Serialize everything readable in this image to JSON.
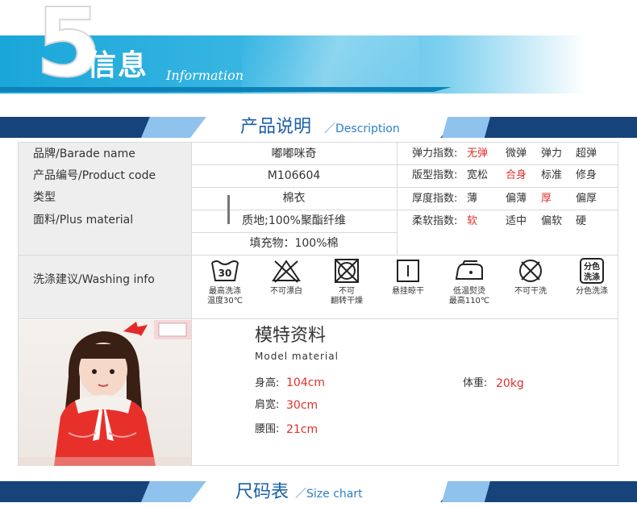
{
  "header": {
    "number": "5",
    "title_cn": "信息",
    "title_en": "Information"
  },
  "sections": {
    "description": {
      "cn": "产品说明",
      "en": "Description"
    },
    "size_chart": {
      "cn": "尺码表",
      "en": "Size chart"
    }
  },
  "product": {
    "brand_label": "品牌/Barade name",
    "brand_value": "嘟嘟咪奇",
    "code_label": "产品编号/Product code",
    "code_value": "M106604",
    "type_label": "类型",
    "type_value": "棉衣",
    "material_label": "面料/Plus material",
    "material_value": "质地;100%聚酯纤维",
    "filling_value": "填充物：100%棉",
    "washing_label": "洗涤建议/Washing info"
  },
  "attributes": [
    {
      "name": "弹力指数:",
      "options": [
        "无弹",
        "微弹",
        "弹力",
        "超弹"
      ],
      "selected": 0
    },
    {
      "name": "版型指数:",
      "options": [
        "宽松",
        "合身",
        "标准",
        "修身"
      ],
      "selected": 1
    },
    {
      "name": "厚度指数:",
      "options": [
        "薄",
        "偏薄",
        "厚",
        "偏厚"
      ],
      "selected": 2
    },
    {
      "name": "柔软指数:",
      "options": [
        "软",
        "适中",
        "偏软",
        "硬"
      ],
      "selected": 0
    }
  ],
  "washing": [
    {
      "icon": "wash-30-icon",
      "label": "最高洗涤\n温度30℃"
    },
    {
      "icon": "no-bleach-icon",
      "label": "不可漂白"
    },
    {
      "icon": "no-tumble-dry-icon",
      "label": "不可\n翻转干燥"
    },
    {
      "icon": "hang-dry-icon",
      "label": "悬挂晾干"
    },
    {
      "icon": "iron-low-icon",
      "label": "低温熨烫\n最高110℃"
    },
    {
      "icon": "no-dry-clean-icon",
      "label": "不可干洗"
    },
    {
      "icon": "separate-wash-icon",
      "label": "分色洗涤",
      "icon_text": "分色\n洗涤"
    }
  ],
  "model": {
    "title_cn": "模特资料",
    "title_en": "Model  material",
    "height_label": "身高:",
    "height_value": "104cm",
    "weight_label": "体重:",
    "weight_value": "20kg",
    "shoulder_label": "肩宽:",
    "shoulder_value": "30cm",
    "waist_label": "腰围:",
    "waist_value": "21cm"
  },
  "colors": {
    "accent_red": "#e0302a",
    "bar_navy": "#16437a",
    "banner_blue": "#1aa6d9"
  }
}
